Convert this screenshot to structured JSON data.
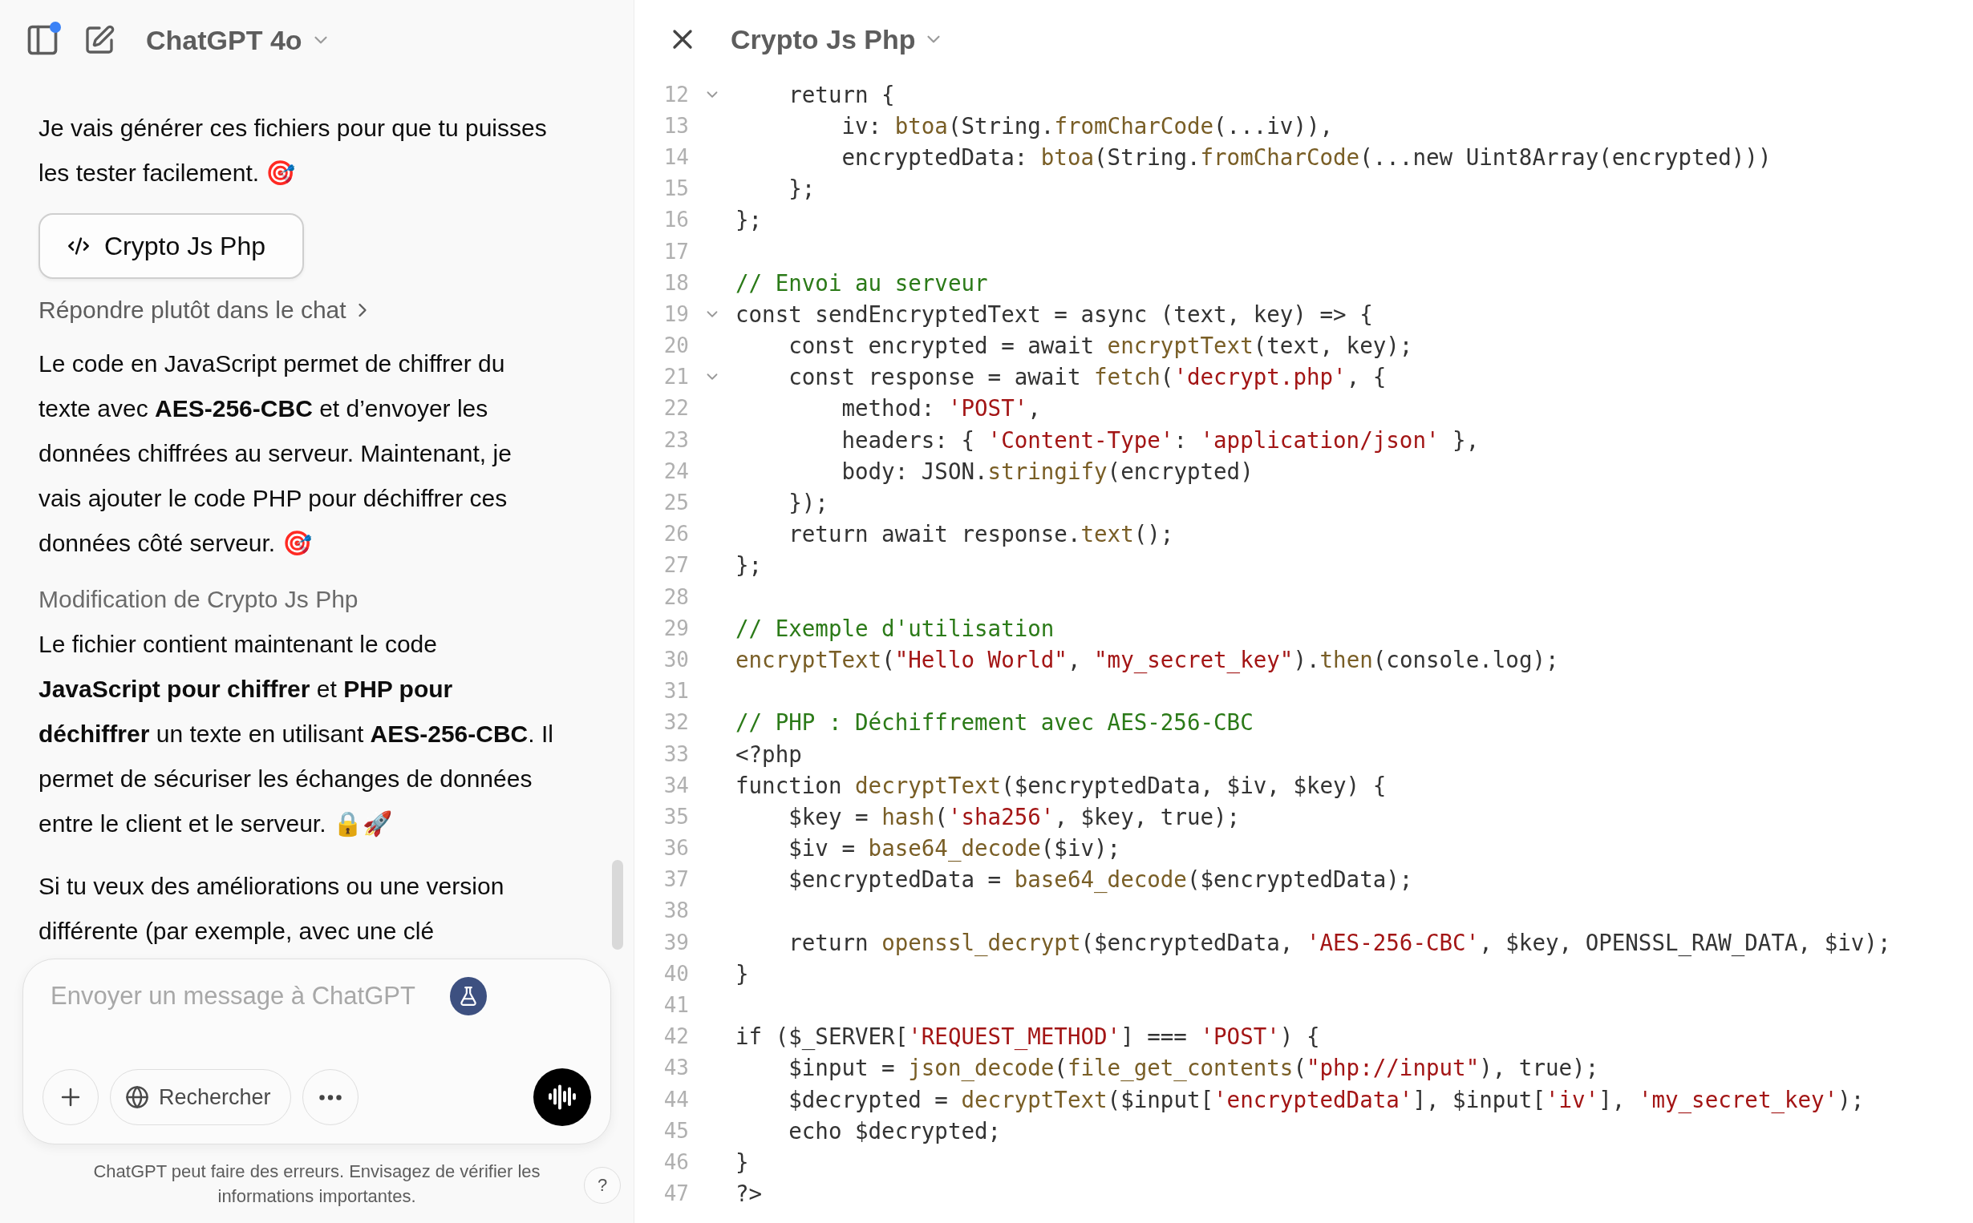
{
  "header": {
    "model_name": "ChatGPT 4o",
    "sidebar_notification": true
  },
  "messages": [
    {
      "kind": "paragraph",
      "text": "Je vais générer ces fichiers pour que tu puisses les tester facilement. 🎯"
    },
    {
      "kind": "canvas_button",
      "text": "Crypto Js Php"
    },
    {
      "kind": "link",
      "text": "Répondre plutôt dans le chat"
    },
    {
      "kind": "paragraph",
      "text": "Le code en JavaScript permet de chiffrer du texte avec **AES-256-CBC** et d’envoyer les données chiffrées au serveur. Maintenant, je vais ajouter le code PHP pour déchiffrer ces données côté serveur. 🎯"
    },
    {
      "kind": "note",
      "text": "Modification de Crypto Js Php"
    },
    {
      "kind": "paragraph",
      "text": "Le fichier contient maintenant le code **JavaScript pour chiffrer** et **PHP pour déchiffrer** un texte en utilisant **AES-256-CBC**. Il permet de sécuriser les échanges de données entre le client et le serveur. 🔒🚀"
    },
    {
      "kind": "paragraph",
      "text": "Si tu veux des améliorations ou une version différente (par exemple, avec une clé"
    }
  ],
  "composer": {
    "placeholder": "Envoyer un message à ChatGPT",
    "search_label": "Rechercher"
  },
  "disclaimer": "ChatGPT peut faire des erreurs. Envisagez de vérifier les informations importantes.",
  "help": "?",
  "canvas": {
    "title": "Crypto Js Php",
    "lines": [
      {
        "number": "12",
        "foldable": true,
        "text": "    return {"
      },
      {
        "number": "13",
        "foldable": false,
        "text": "        iv: btoa(String.fromCharCode(...iv)),"
      },
      {
        "number": "14",
        "foldable": false,
        "text": "        encryptedData: btoa(String.fromCharCode(...new Uint8Array(encrypted)))"
      },
      {
        "number": "15",
        "foldable": false,
        "text": "    };"
      },
      {
        "number": "16",
        "foldable": false,
        "text": "};"
      },
      {
        "number": "17",
        "foldable": false
      },
      {
        "number": "18",
        "foldable": false,
        "text": "// Envoi au serveur"
      },
      {
        "number": "19",
        "foldable": true,
        "text": "const sendEncryptedText = async (text, key) => {"
      },
      {
        "number": "20",
        "foldable": false,
        "text": "    const encrypted = await encryptText(text, key);"
      },
      {
        "number": "21",
        "foldable": true,
        "text": "    const response = await fetch('decrypt.php', {"
      },
      {
        "number": "22",
        "foldable": false,
        "text": "        method: 'POST',"
      },
      {
        "number": "23",
        "foldable": false,
        "text": "        headers: { 'Content-Type': 'application/json' },"
      },
      {
        "number": "24",
        "foldable": false,
        "text": "        body: JSON.stringify(encrypted)"
      },
      {
        "number": "25",
        "foldable": false,
        "text": "    });"
      },
      {
        "number": "26",
        "foldable": false,
        "text": "    return await response.text();"
      },
      {
        "number": "27",
        "foldable": false,
        "text": "};"
      },
      {
        "number": "28",
        "foldable": false
      },
      {
        "number": "29",
        "foldable": false,
        "text": "// Exemple d'utilisation"
      },
      {
        "number": "30",
        "foldable": false,
        "text": "encryptText(\"Hello World\", \"my_secret_key\").then(console.log);"
      },
      {
        "number": "31",
        "foldable": false
      },
      {
        "number": "32",
        "foldable": false,
        "text": "// PHP : Déchiffrement avec AES-256-CBC"
      },
      {
        "number": "33",
        "foldable": false,
        "text": "<?php"
      },
      {
        "number": "34",
        "foldable": false,
        "text": "function decryptText($encryptedData, $iv, $key) {"
      },
      {
        "number": "35",
        "foldable": false,
        "text": "    $key = hash('sha256', $key, true);"
      },
      {
        "number": "36",
        "foldable": false,
        "text": "    $iv = base64_decode($iv);"
      },
      {
        "number": "37",
        "foldable": false,
        "text": "    $encryptedData = base64_decode($encryptedData);"
      },
      {
        "number": "38",
        "foldable": false
      },
      {
        "number": "39",
        "foldable": false,
        "text": "    return openssl_decrypt($encryptedData, 'AES-256-CBC', $key, OPENSSL_RAW_DATA, $iv);"
      },
      {
        "number": "40",
        "foldable": false,
        "text": "}"
      },
      {
        "number": "41",
        "foldable": false
      },
      {
        "number": "42",
        "foldable": false,
        "text": "if ($_SERVER['REQUEST_METHOD'] === 'POST') {"
      },
      {
        "number": "43",
        "foldable": false,
        "text": "    $input = json_decode(file_get_contents(\"php://input\"), true);"
      },
      {
        "number": "44",
        "foldable": false,
        "text": "    $decrypted = decryptText($input['encryptedData'], $input['iv'], 'my_secret_key');"
      },
      {
        "number": "45",
        "foldable": false,
        "text": "    echo $decrypted;"
      },
      {
        "number": "46",
        "foldable": false,
        "text": "}"
      },
      {
        "number": "47",
        "foldable": false,
        "text": "?>"
      }
    ]
  }
}
